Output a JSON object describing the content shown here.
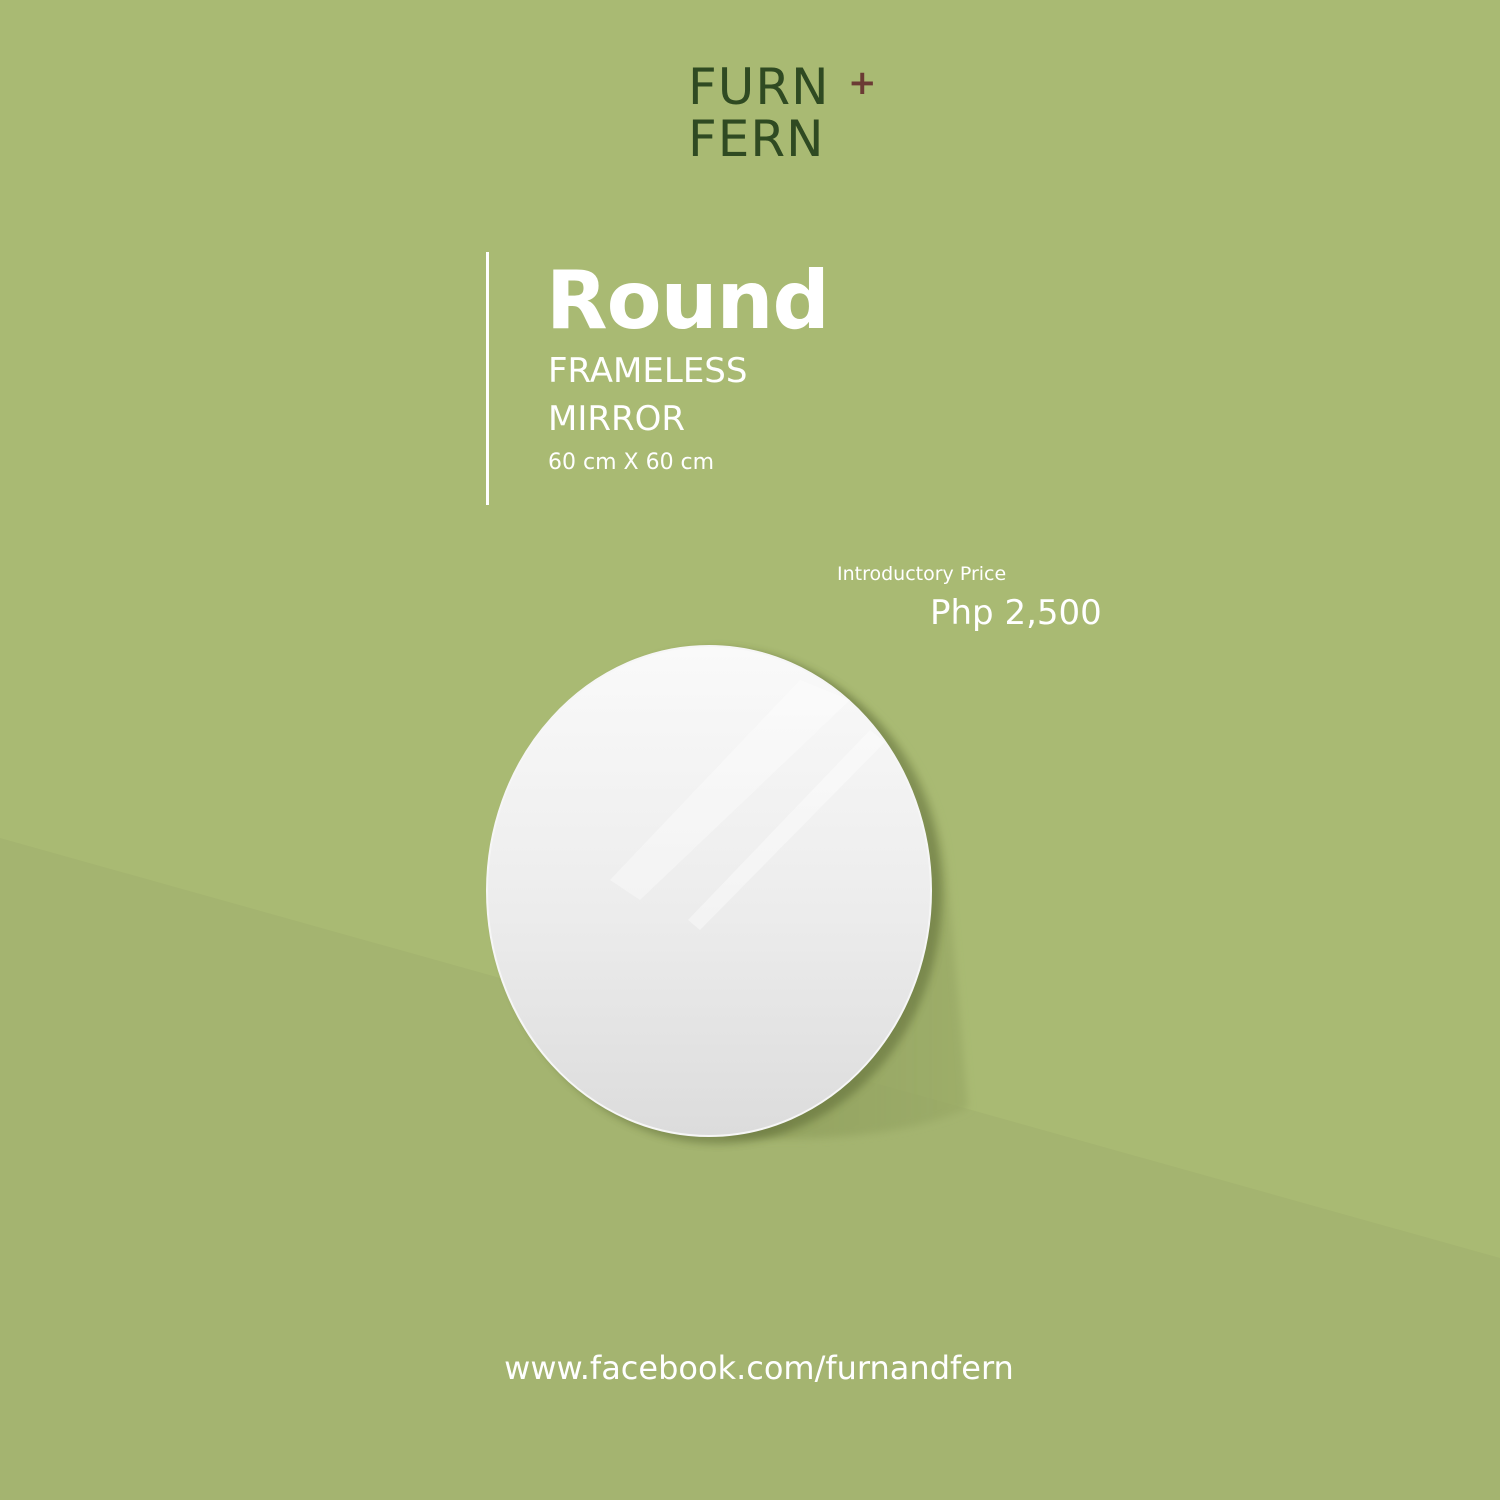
{
  "brand": {
    "line1": "FURN",
    "line2": "FERN",
    "plus": "+",
    "text_color": "#2f4a22",
    "plus_color": "#6b3b34"
  },
  "product": {
    "title": "Round",
    "subtitle_line1": "FRAMELESS",
    "subtitle_line2": "MIRROR",
    "size": "60 cm X 60 cm"
  },
  "pricing": {
    "label": "Introductory Price",
    "price": "Php 2,500"
  },
  "footer": {
    "url": "www.facebook.com/furnandfern"
  },
  "colors": {
    "background": "#a9ba73",
    "floor": "#a4b470",
    "text": "#ffffff",
    "mirror": "#ececec"
  }
}
